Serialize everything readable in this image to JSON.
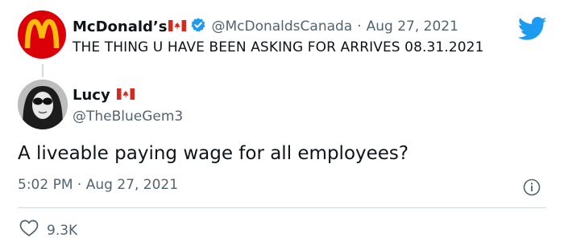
{
  "parent_tweet": {
    "name": "McDonald’s",
    "handle": "@McDonaldsCanada",
    "separator": "·",
    "date": "Aug 27, 2021",
    "text": "THE THING U HAVE BEEN ASKING FOR ARRIVES 08.31.2021",
    "avatar_color": "#db0007",
    "logo_color": "#ffbc0d"
  },
  "reply_tweet": {
    "name": "Lucy",
    "handle": "@TheBlueGem3",
    "text": "A liveable paying wage for all employees?",
    "timestamp": "5:02 PM · Aug 27, 2021"
  },
  "engagement": {
    "likes": "9.3K"
  },
  "icons": {
    "verified": "verified-badge-icon",
    "flag": "canada-flag-icon",
    "brand": "twitter-bird-icon",
    "info": "info-icon",
    "like": "heart-icon"
  },
  "colors": {
    "text": "#0f1419",
    "secondary": "#536471",
    "twitter_blue": "#1d9bf0",
    "divider": "#cfd9de"
  }
}
